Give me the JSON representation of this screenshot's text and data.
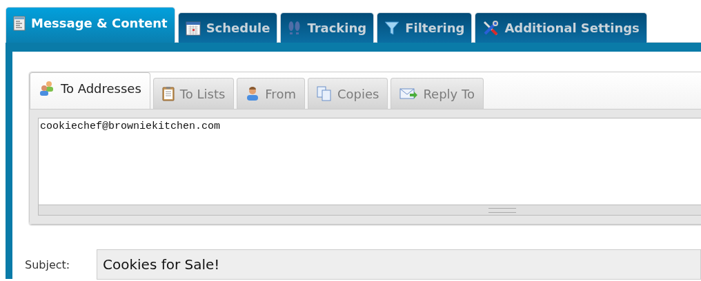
{
  "main_tabs": [
    {
      "label": "Message & Content",
      "selected": true
    },
    {
      "label": "Schedule",
      "selected": false
    },
    {
      "label": "Tracking",
      "selected": false
    },
    {
      "label": "Filtering",
      "selected": false
    },
    {
      "label": "Additional Settings",
      "selected": false
    }
  ],
  "recipient_tabs": [
    {
      "label": "To Addresses",
      "selected": true
    },
    {
      "label": "To Lists",
      "selected": false
    },
    {
      "label": "From",
      "selected": false
    },
    {
      "label": "Copies",
      "selected": false
    },
    {
      "label": "Reply To",
      "selected": false
    }
  ],
  "addresses": {
    "value": "cookiechef@browniekitchen.com"
  },
  "subject": {
    "label": "Subject:",
    "value": "Cookies for Sale!"
  }
}
